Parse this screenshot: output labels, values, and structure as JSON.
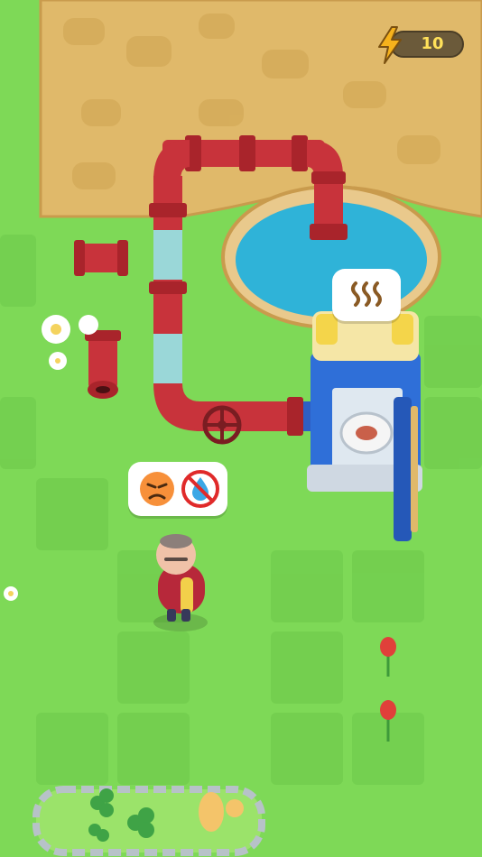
{
  "hud": {
    "energy_count": "10",
    "energy_icon": "lightning-bolt-icon"
  },
  "speech_bubbles": [
    {
      "name": "toilet-status-bubble",
      "icon": "smell-waves-icon"
    },
    {
      "name": "character-mood-bubble",
      "icons": [
        "angry-face-icon",
        "no-water-icon"
      ]
    }
  ],
  "colors": {
    "grass": "#7ed957",
    "grass_tile": "#6cc84a",
    "dirt": "#e0b96a",
    "pipe_red": "#c8333b",
    "pipe_glass": "#9fd6ef",
    "water": "#2fb3d8",
    "energy_text": "#ffe15a"
  }
}
